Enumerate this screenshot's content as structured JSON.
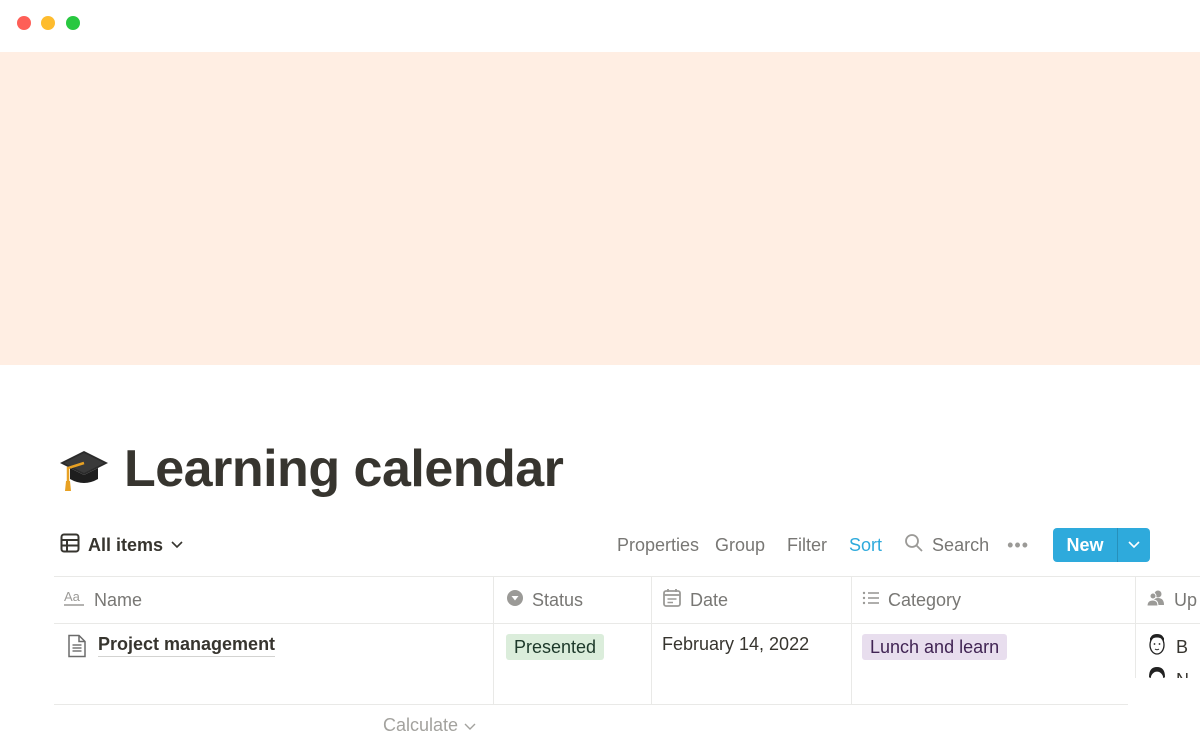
{
  "window": {
    "controls": [
      "close",
      "minimize",
      "maximize"
    ]
  },
  "cover": {
    "color": "#ffeee3"
  },
  "page": {
    "icon": "graduation-cap-icon",
    "title": "Learning calendar"
  },
  "view": {
    "current_view": "All items",
    "view_icon": "table-icon",
    "actions": {
      "properties": "Properties",
      "group": "Group",
      "filter": "Filter",
      "sort": "Sort",
      "search": "Search",
      "more": "•••",
      "new": "New"
    },
    "accent_color": "#2eaadc"
  },
  "table": {
    "columns": [
      {
        "label": "Name",
        "icon": "text-aa-icon"
      },
      {
        "label": "Status",
        "icon": "select-icon"
      },
      {
        "label": "Date",
        "icon": "calendar-icon"
      },
      {
        "label": "Category",
        "icon": "list-icon"
      },
      {
        "label": "Up",
        "icon": "person-icon"
      }
    ],
    "rows": [
      {
        "name": "Project management",
        "status": "Presented",
        "status_color": "#dbeddb",
        "date": "February 14, 2022",
        "category": "Lunch and learn",
        "category_color": "#e8deee",
        "people": [
          "B",
          "N"
        ]
      }
    ],
    "footer": {
      "calculate": "Calculate"
    }
  }
}
